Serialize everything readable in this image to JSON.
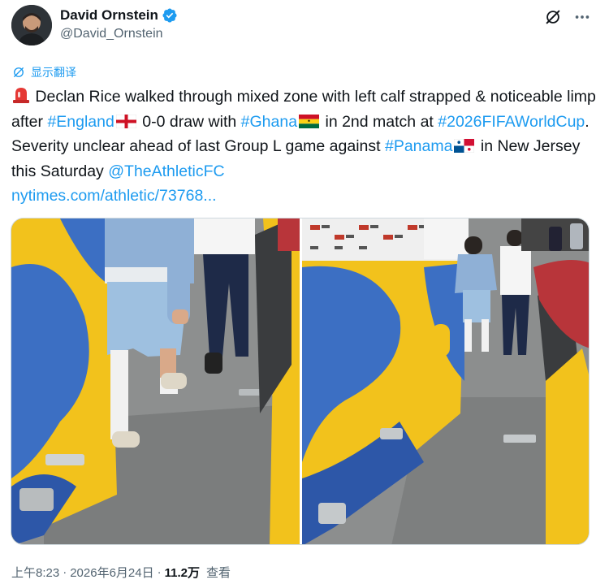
{
  "author": {
    "display_name": "David Ornstein",
    "handle": "@David_Ornstein",
    "verified": true
  },
  "icons": {
    "avatar": "avatar-image",
    "verified": "verified-badge-icon",
    "grok": "grok-icon",
    "more": "more-icon",
    "translate": "translate-icon",
    "siren": "rotating-light-emoji",
    "flag_england": "england-flag-emoji",
    "flag_ghana": "ghana-flag-emoji",
    "flag_panama": "panama-flag-emoji"
  },
  "translate_label": "显示翻译",
  "tweet": {
    "t1": " Declan Rice walked through mixed zone with left calf strapped & noticeable limp after ",
    "h_england": "#England",
    "t2": " 0-0 draw with ",
    "h_ghana": "#Ghana",
    "t3": " in 2nd match at ",
    "h_worldcup": "#2026FIFAWorldCup",
    "t4": ". Severity unclear ahead of last Group L game against ",
    "h_panama": "#Panama",
    "t5": " in New Jersey this Saturday ",
    "mention": "@TheAthleticFC",
    "link": "nytimes.com/athletic/73768..."
  },
  "media": {
    "photo_left": "mixed-zone-photo-close",
    "photo_right": "mixed-zone-photo-wide"
  },
  "footer": {
    "time": "上午8:23",
    "dot1": "·",
    "date": "2026年6月24日",
    "dot2": "·",
    "views_count": "11.2万",
    "views_label": "查看"
  },
  "colors": {
    "accent": "#1d9bf0",
    "text": "#0f1419",
    "secondary": "#536471",
    "wall_blue": "#3a6fc4",
    "wall_yellow": "#f5c31c"
  }
}
